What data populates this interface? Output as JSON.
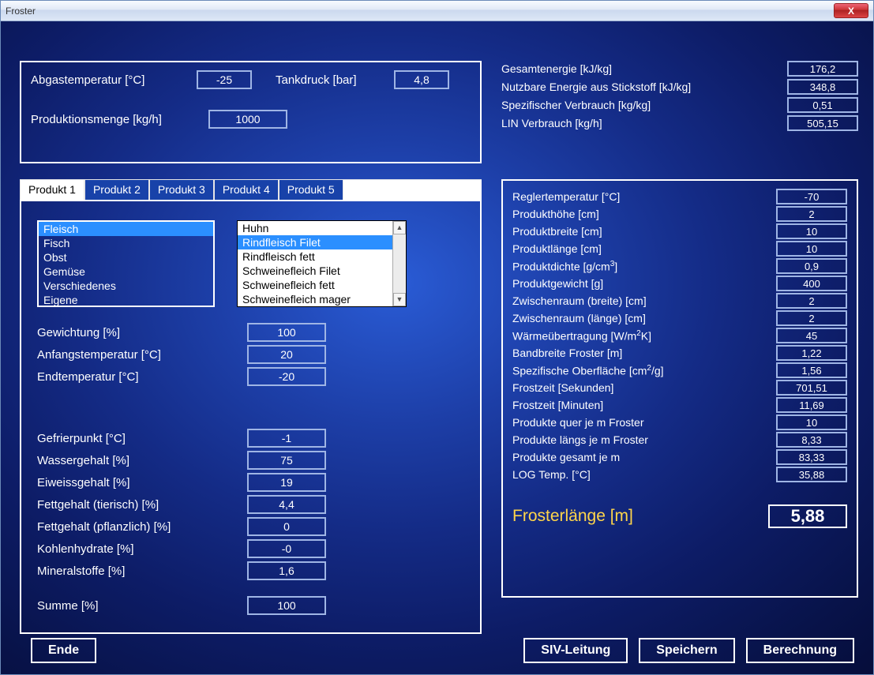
{
  "window": {
    "title": "Froster",
    "close": "X"
  },
  "top_inputs": {
    "exhaust_label": "Abgastemperatur [°C]",
    "exhaust_val": "-25",
    "pressure_label": "Tankdruck [bar]",
    "pressure_val": "4,8",
    "prod_label": "Produktionsmenge [kg/h]",
    "prod_val": "1000"
  },
  "tabs": [
    "Produkt 1",
    "Produkt 2",
    "Produkt 3",
    "Produkt 4",
    "Produkt 5"
  ],
  "categories": [
    "Fleisch",
    "Fisch",
    "Obst",
    "Gemüse",
    "Verschiedenes",
    "Eigene"
  ],
  "category_selected": "Fleisch",
  "subitems": [
    "Huhn",
    "Rindfleisch Filet",
    "Rindfleisch fett",
    "Schweinefleich Filet",
    "Schweinefleich fett",
    "Schweinefleich mager"
  ],
  "subitem_selected": "Rindfleisch Filet",
  "prodparams": [
    {
      "label": "Gewichtung [%]",
      "val": "100"
    },
    {
      "label": "Anfangstemperatur [°C]",
      "val": "20"
    },
    {
      "label": "Endtemperatur [°C]",
      "val": "-20"
    }
  ],
  "composition": [
    {
      "label": "Gefrierpunkt [°C]",
      "val": "-1"
    },
    {
      "label": "Wassergehalt [%]",
      "val": "75"
    },
    {
      "label": "Eiweissgehalt [%]",
      "val": "19"
    },
    {
      "label": "Fettgehalt (tierisch) [%]",
      "val": "4,4"
    },
    {
      "label": "Fettgehalt (pflanzlich) [%]",
      "val": "0"
    },
    {
      "label": "Kohlenhydrate [%]",
      "val": "-0"
    },
    {
      "label": "Mineralstoffe [%]",
      "val": "1,6"
    }
  ],
  "sum": {
    "label": "Summe [%]",
    "val": "100"
  },
  "energy": [
    {
      "label": "Gesamtenergie [kJ/kg]",
      "val": "176,2"
    },
    {
      "label": "Nutzbare Energie aus Stickstoff [kJ/kg]",
      "val": "348,8"
    },
    {
      "label": "Spezifischer Verbrauch [kg/kg]",
      "val": "0,51"
    },
    {
      "label": "LIN Verbrauch [kg/h]",
      "val": "505,15"
    }
  ],
  "regler": [
    {
      "label": "Reglertemperatur [°C]",
      "val": "-70"
    },
    {
      "label": "Produkthöhe [cm]",
      "val": "2"
    },
    {
      "label": "Produktbreite [cm]",
      "val": "10"
    },
    {
      "label": "Produktlänge [cm]",
      "val": "10"
    },
    {
      "label_html": "Produktdichte [g/cm<sup>3</sup>]",
      "label": "Produktdichte [g/cm3]",
      "val": "0,9"
    },
    {
      "label": "Produktgewicht [g]",
      "val": "400"
    },
    {
      "label": "Zwischenraum (breite) [cm]",
      "val": "2"
    },
    {
      "label": "Zwischenraum (länge) [cm]",
      "val": "2"
    },
    {
      "label_html": "Wärmeübertragung [W/m<sup>2</sup>K]",
      "label": "Wärmeübertragung [W/m2K]",
      "val": "45"
    },
    {
      "label": "Bandbreite Froster [m]",
      "val": "1,22"
    },
    {
      "label_html": "Spezifische Oberfläche [cm<sup>2</sup>/g]",
      "label": "Spezifische Oberfläche [cm2/g]",
      "val": "1,56"
    },
    {
      "label": "Frostzeit [Sekunden]",
      "val": "701,51"
    },
    {
      "label": "Frostzeit [Minuten]",
      "val": "11,69"
    },
    {
      "label": "Produkte quer je m Froster",
      "val": "10"
    },
    {
      "label": "Produkte längs je m Froster",
      "val": "8,33"
    },
    {
      "label": "Produkte gesamt je m",
      "val": "83,33"
    },
    {
      "label": "LOG Temp. [°C]",
      "val": "35,88"
    }
  ],
  "result": {
    "label": "Frosterlänge [m]",
    "val": "5,88"
  },
  "buttons": {
    "ende": "Ende",
    "siv": "SIV-Leitung",
    "save": "Speichern",
    "calc": "Berechnung"
  }
}
